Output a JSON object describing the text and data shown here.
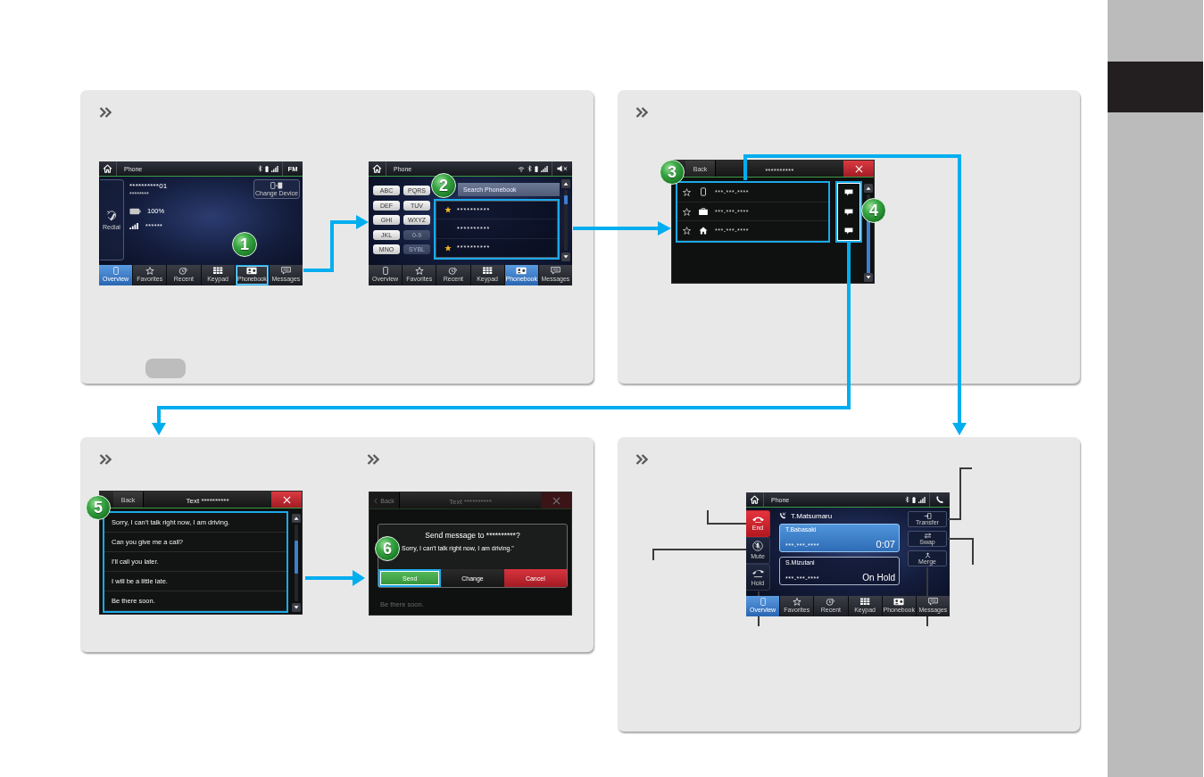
{
  "panels": [
    {
      "kind": "pair",
      "sections": [
        {
          "key_icon": true,
          "screens": [
            {
              "kind": "overview",
              "step": "1",
              "status_bar": {
                "title": "Phone",
                "source": "FM"
              },
              "redial": "Redial",
              "device": "**********01",
              "device_sub": "********",
              "battery": "100%",
              "carrier": "******",
              "change_device": "Change Device",
              "tabs": [
                {
                  "label": "Overview",
                  "selected": true,
                  "highlighted": false
                },
                {
                  "label": "Favorites",
                  "selected": false,
                  "highlighted": false
                },
                {
                  "label": "Recent",
                  "selected": false,
                  "highlighted": false
                },
                {
                  "label": "Keypad",
                  "selected": false,
                  "highlighted": false
                },
                {
                  "label": "Phonebook",
                  "selected": false,
                  "highlighted": true
                },
                {
                  "label": "Messages",
                  "selected": false,
                  "highlighted": false
                }
              ]
            },
            {
              "kind": "phonebook",
              "step": "2",
              "status_bar": {
                "title": "Phone"
              },
              "keys": [
                {
                  "label": "ABC",
                  "disabled": false
                },
                {
                  "label": "PQRS",
                  "disabled": false
                },
                {
                  "label": "DEF",
                  "disabled": false
                },
                {
                  "label": "TUV",
                  "disabled": false
                },
                {
                  "label": "GHI",
                  "disabled": false
                },
                {
                  "label": "WXYZ",
                  "disabled": false
                },
                {
                  "label": "JKL",
                  "disabled": false
                },
                {
                  "label": "0-9",
                  "disabled": true
                },
                {
                  "label": "MNO",
                  "disabled": false
                },
                {
                  "label": "SYBL",
                  "disabled": true
                }
              ],
              "search": "Search Phonebook",
              "contacts": [
                {
                  "name": "**********",
                  "favorite": true
                },
                {
                  "name": "**********",
                  "favorite": false
                },
                {
                  "name": "**********",
                  "favorite": true
                }
              ],
              "tabs": [
                {
                  "label": "Overview",
                  "selected": false
                },
                {
                  "label": "Favorites",
                  "selected": false
                },
                {
                  "label": "Recent",
                  "selected": false
                },
                {
                  "label": "Keypad",
                  "selected": false
                },
                {
                  "label": "Phonebook",
                  "selected": true
                },
                {
                  "label": "Messages",
                  "selected": false
                }
              ]
            }
          ]
        }
      ]
    },
    {
      "kind": "single",
      "sections": [
        {
          "screens": [
            {
              "kind": "contact",
              "step": "3",
              "message_step": "4",
              "back": "Back",
              "title": "**********",
              "numbers": [
                {
                  "kind": "mobile",
                  "number": "***-***-****",
                  "favorite": false
                },
                {
                  "kind": "work",
                  "number": "***-***-****",
                  "favorite": false
                },
                {
                  "kind": "home",
                  "number": "***-***-****",
                  "favorite": false
                }
              ]
            }
          ]
        }
      ]
    },
    {
      "kind": "split",
      "sections": [
        {
          "screens": [
            {
              "kind": "messages",
              "step": "5",
              "back": "Back",
              "title": "Text **********",
              "messages": [
                "Sorry, I can't talk right now, I am driving.",
                "Can you give me a call?",
                "I'll call you later.",
                "I will be a little late.",
                "Be there soon."
              ]
            }
          ]
        },
        {
          "screens": [
            {
              "kind": "confirm",
              "step": "6",
              "back": "Back",
              "title": "Text **********",
              "dialog_title": "Send message to **********?",
              "dialog_text": "Sorry, I can't talk right now, I am driving.\"",
              "buttons": [
                {
                  "label": "Send",
                  "kind": "send",
                  "highlighted": true
                },
                {
                  "label": "Change",
                  "kind": "change",
                  "highlighted": false
                },
                {
                  "label": "Cancel",
                  "kind": "cancel",
                  "highlighted": false
                }
              ],
              "behind": "Be there soon."
            }
          ]
        }
      ]
    },
    {
      "kind": "callout",
      "sections": [
        {
          "screens": [
            {
              "kind": "call",
              "status_bar": {
                "title": "Phone"
              },
              "caller": "T.Matsumaru",
              "calls": [
                {
                  "name": "T.Babasaki",
                  "number": "***-***-****",
                  "status": "0:07",
                  "active": true
                },
                {
                  "name": "S.Mizutani",
                  "number": "***-***-****",
                  "status": "On Hold",
                  "active": false
                }
              ],
              "left_buttons": [
                {
                  "label": "End",
                  "kind": "end"
                },
                {
                  "label": "Mute",
                  "kind": "mute"
                },
                {
                  "label": "Hold",
                  "kind": "hold"
                }
              ],
              "right_buttons": [
                {
                  "label": "Transfer",
                  "kind": "transfer"
                },
                {
                  "label": "Swap",
                  "kind": "swap"
                },
                {
                  "label": "Merge",
                  "kind": "merge"
                }
              ],
              "tabs": [
                {
                  "label": "Overview",
                  "selected": true
                },
                {
                  "label": "Favorites",
                  "selected": false
                },
                {
                  "label": "Recent",
                  "selected": false
                },
                {
                  "label": "Keypad",
                  "selected": false
                },
                {
                  "label": "Phonebook",
                  "selected": false
                },
                {
                  "label": "Messages",
                  "selected": false
                }
              ]
            }
          ]
        }
      ]
    }
  ]
}
